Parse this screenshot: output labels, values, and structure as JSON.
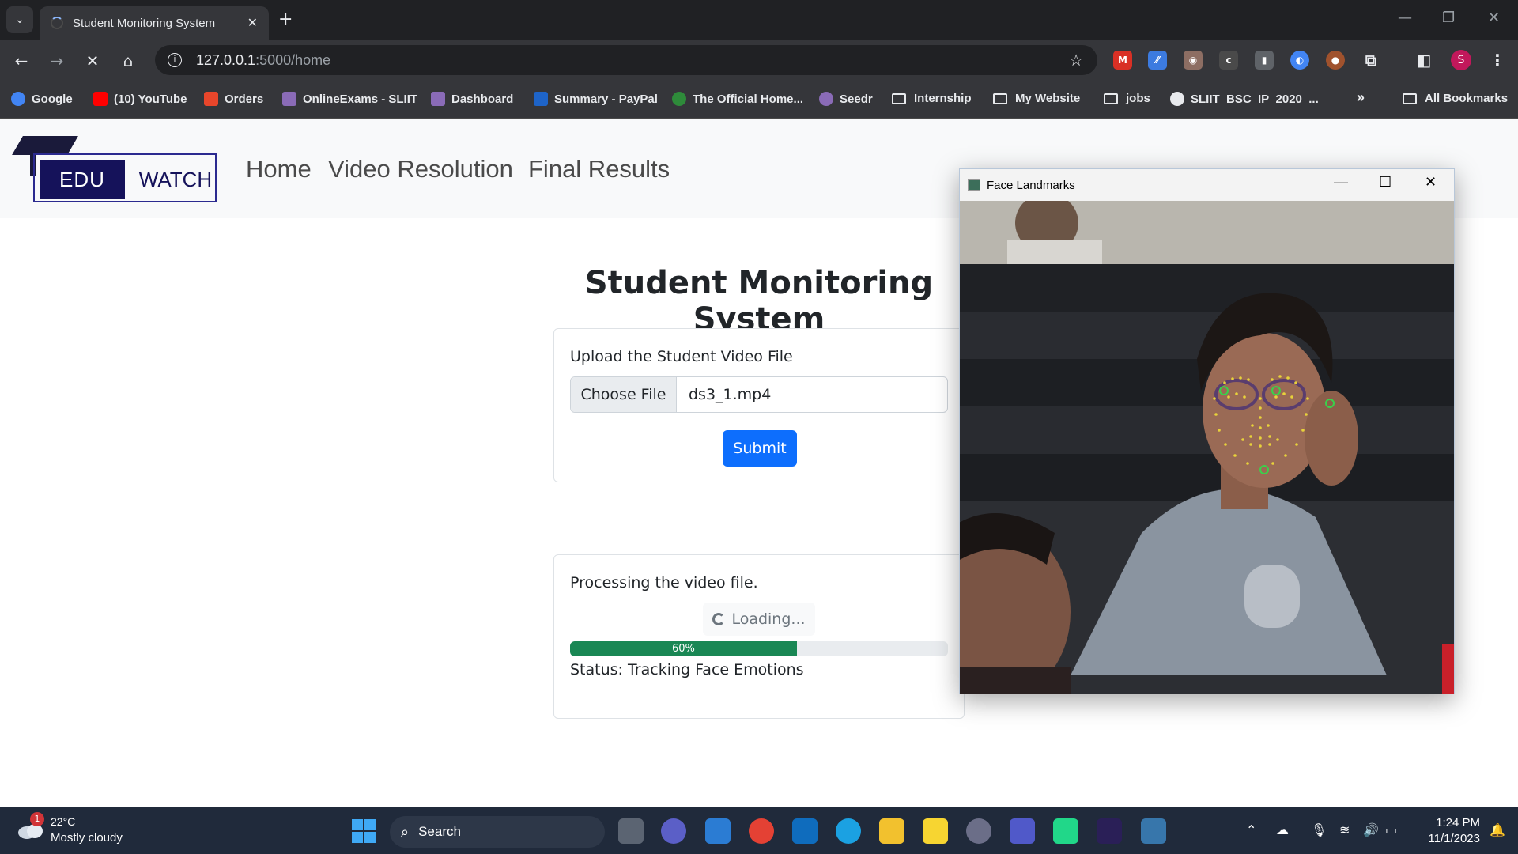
{
  "browser": {
    "tab_title": "Student Monitoring System",
    "tab_close": "✕",
    "new_tab": "+",
    "url_host": "127.0.0.1",
    "url_path": ":5000/home",
    "profile_initial": "S",
    "bookmarks": [
      {
        "label": "Google",
        "color": "#4285f4"
      },
      {
        "label": "(10) YouTube",
        "color": "#ff0000"
      },
      {
        "label": "Orders",
        "color": "#e8462b"
      },
      {
        "label": "OnlineExams - SLIIT",
        "color": "#8a6bb7"
      },
      {
        "label": "Dashboard",
        "color": "#8a6bb7"
      },
      {
        "label": "Summary - PayPal",
        "color": "#1e64c8"
      },
      {
        "label": "The Official Home...",
        "color": "#2e8b3a"
      },
      {
        "label": "Seedr",
        "color": "#8a6bb7"
      },
      {
        "label": "Internship",
        "folder": true
      },
      {
        "label": "My Website",
        "folder": true
      },
      {
        "label": "jobs",
        "folder": true
      },
      {
        "label": "SLIIT_BSC_IP_2020_...",
        "color": "#e8eaed"
      }
    ],
    "overflow_label": "»",
    "all_bookmarks": "All Bookmarks"
  },
  "site": {
    "logo_edu": "EDU",
    "logo_watch": "WATCH",
    "nav": [
      "Home",
      "Video Resolution",
      "Final Results"
    ]
  },
  "main": {
    "title": "Student Monitoring System",
    "upload_label": "Upload the Student Video File",
    "choose_file": "Choose File",
    "file_name": "ds3_1.mp4",
    "submit": "Submit",
    "processing_text": "Processing the video file.",
    "loading": "Loading...",
    "progress_percent": 60,
    "progress_label": "60%",
    "status": "Status: Tracking Face Emotions"
  },
  "cv_window": {
    "title": "Face Landmarks"
  },
  "taskbar": {
    "weather_badge": "1",
    "temperature": "22°C",
    "weather": "Mostly cloudy",
    "search": "Search",
    "time": "1:24 PM",
    "date": "11/1/2023"
  },
  "colors": {
    "accent": "#0d6efd",
    "progress": "#198754",
    "logo_navy": "#15125a"
  }
}
